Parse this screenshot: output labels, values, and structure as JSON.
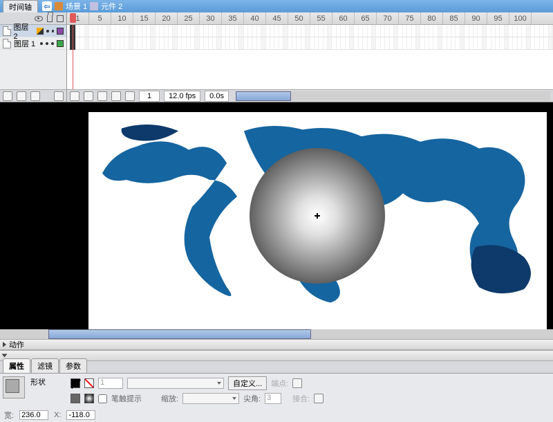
{
  "topbar": {
    "timeline_tab": "时间轴",
    "scene": "场景 1",
    "symbol": "元件 2"
  },
  "layers": {
    "items": [
      {
        "name": "图层 2",
        "color": "#8a4aa8"
      },
      {
        "name": "图层 1",
        "color": "#3aa84a"
      }
    ]
  },
  "ruler": {
    "ticks": [
      "1",
      "5",
      "10",
      "15",
      "20",
      "25",
      "30",
      "35",
      "40",
      "45",
      "50",
      "55",
      "60",
      "65",
      "70",
      "75",
      "80",
      "85",
      "90",
      "95",
      "100"
    ]
  },
  "tl_foot": {
    "frame": "1",
    "fps": "12.0 fps",
    "time": "0.0s"
  },
  "actions_panel": "动作",
  "prop_tabs": {
    "props": "属性",
    "filters": "滤镜",
    "params": "参数"
  },
  "props": {
    "shape": "形状",
    "stroke_hint": "笔触提示",
    "scale": "缩放:",
    "miter": "尖角:",
    "miter_val": "3",
    "endpoint": "端点:",
    "join": "接合:",
    "custom": "自定义..."
  },
  "coords": {
    "w_label": "宽:",
    "w": "236.0",
    "x_label": "X:",
    "x": "-118.0",
    "stroke_w": "1"
  }
}
